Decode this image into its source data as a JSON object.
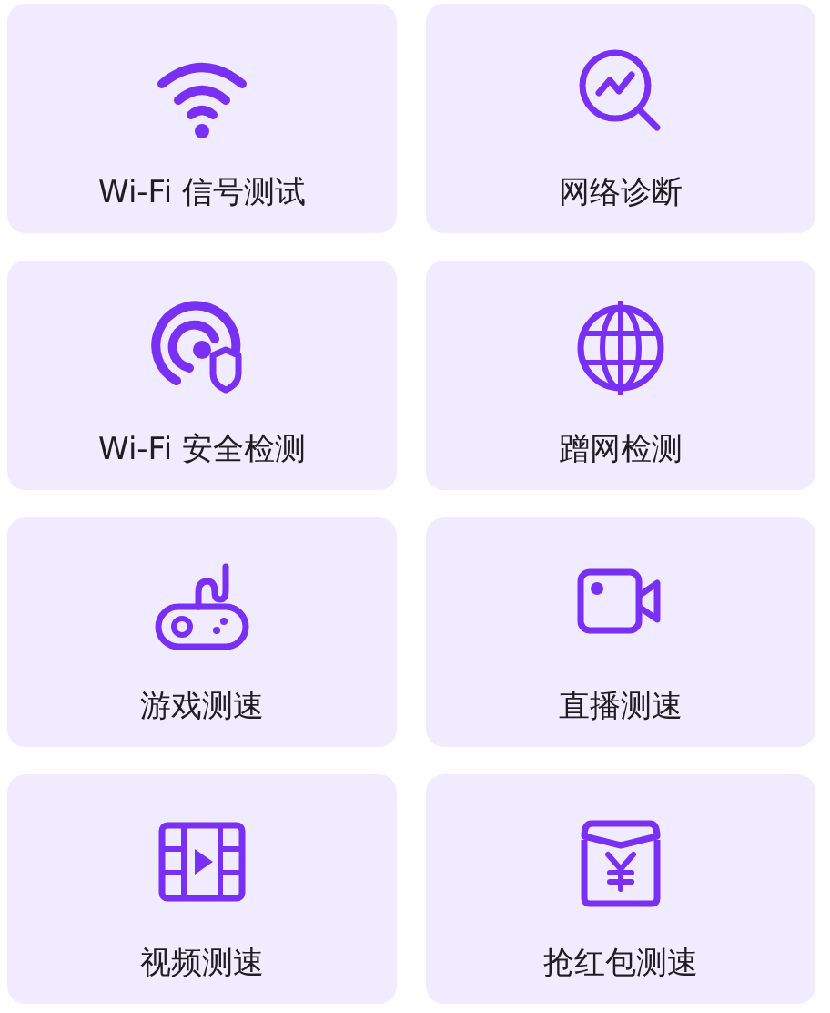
{
  "tools": [
    {
      "label": "Wi-Fi 信号测试",
      "kind": "wifi"
    },
    {
      "label": "网络诊断",
      "kind": "diagnose"
    },
    {
      "label": "Wi-Fi 安全检测",
      "kind": "security"
    },
    {
      "label": "蹭网检测",
      "kind": "globe"
    },
    {
      "label": "游戏测速",
      "kind": "game"
    },
    {
      "label": "直播测速",
      "kind": "live"
    },
    {
      "label": "视频测速",
      "kind": "video"
    },
    {
      "label": "抢红包测速",
      "kind": "redpacket"
    }
  ]
}
